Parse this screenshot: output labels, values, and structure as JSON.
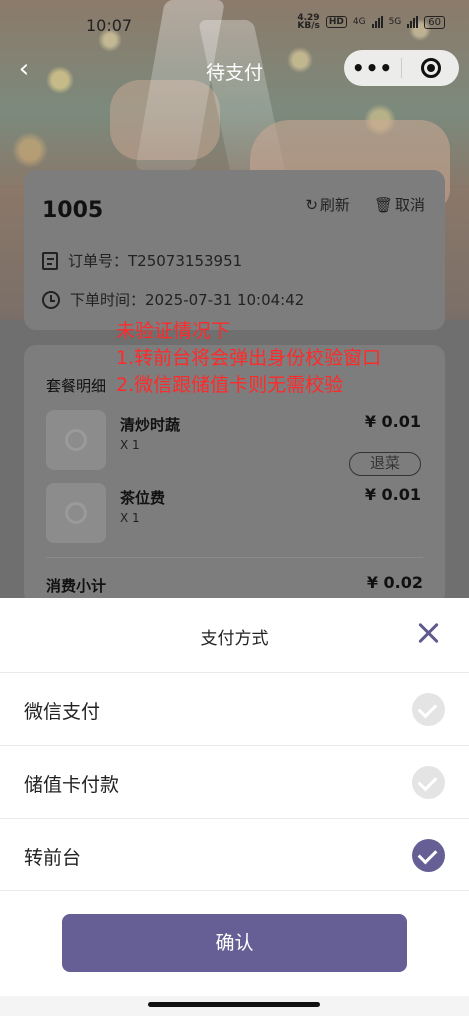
{
  "status_bar": {
    "time": "10:07",
    "net_speed": "4.29\nKB/s",
    "hd_badge": "HD",
    "net1": "4G",
    "net2": "5G",
    "battery": "60"
  },
  "nav": {
    "title": "待支付"
  },
  "order": {
    "table_no": "1005",
    "refresh_label": "刷新",
    "cancel_label": "取消",
    "order_no_label": "订单号：",
    "order_no": "T25073153951",
    "time_label": "下单时间：",
    "time": "2025-07-31 10:04:42"
  },
  "details": {
    "section_title": "套餐明细",
    "items": [
      {
        "name": "清炒时蔬",
        "qty": "X 1",
        "price": "¥ 0.01",
        "refund_label": "退菜"
      },
      {
        "name": "茶位费",
        "qty": "X 1",
        "price": "¥ 0.01"
      }
    ],
    "subtotal_label": "消费小计",
    "subtotal": "¥ 0.02"
  },
  "annotation": {
    "line1": "未验证情况下",
    "line2": "1.转前台将会弹出身份校验窗口",
    "line3": "2.微信跟储值卡则无需校验"
  },
  "payment_sheet": {
    "title": "支付方式",
    "options": [
      {
        "label": "微信支付",
        "selected": false
      },
      {
        "label": "储值卡付款",
        "selected": false
      },
      {
        "label": "转前台",
        "selected": true
      }
    ],
    "confirm_label": "确认"
  },
  "colors": {
    "accent": "#665f95",
    "annotation": "#ff2a2a"
  }
}
